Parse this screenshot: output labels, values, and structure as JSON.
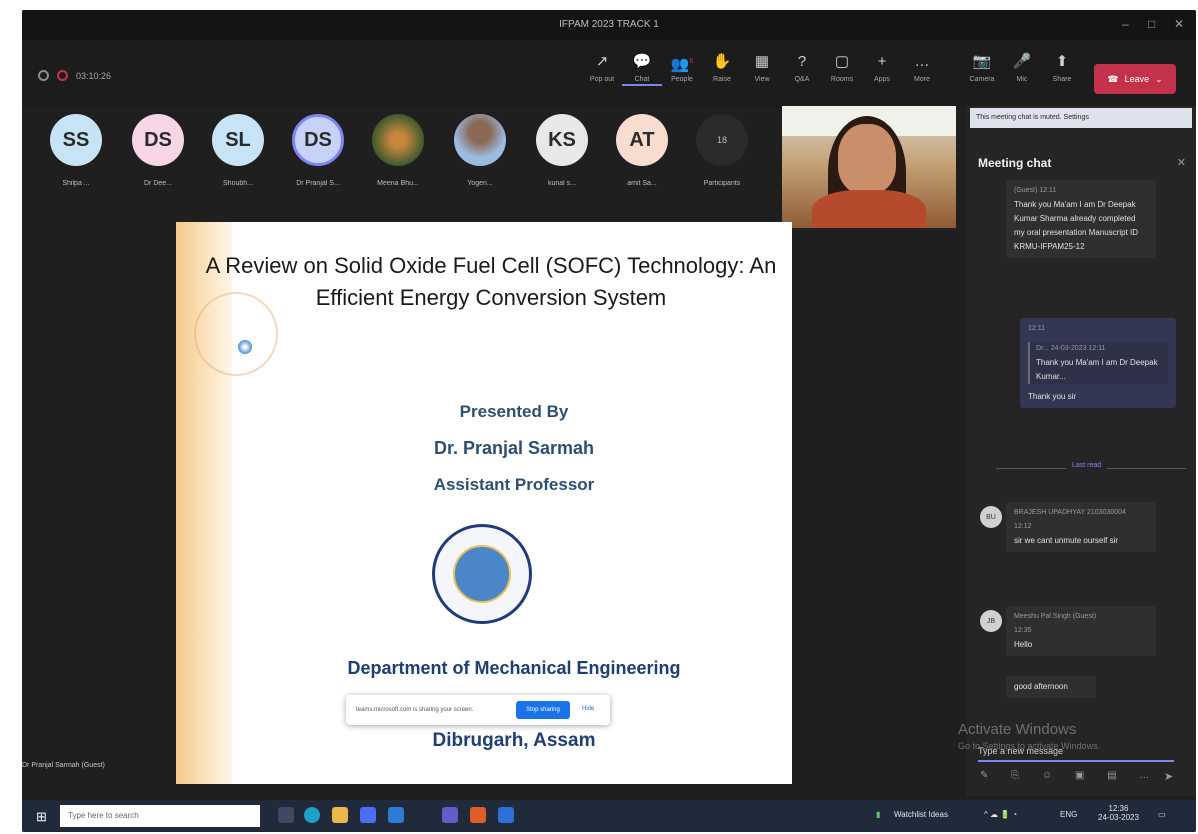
{
  "window": {
    "title": "IFPAM 2023 TRACK 1",
    "controls": [
      "–",
      "□",
      "✕"
    ]
  },
  "meeting": {
    "timer": "03:10:26"
  },
  "toolbar": {
    "buttons": [
      {
        "label": "Pop out",
        "icon": "↗"
      },
      {
        "label": "Chat",
        "icon": "💬"
      },
      {
        "label": "People",
        "icon": "👥"
      },
      {
        "label": "Raise",
        "icon": "✋"
      },
      {
        "label": "View",
        "icon": "▦"
      },
      {
        "label": "Q&A",
        "icon": "?"
      },
      {
        "label": "Rooms",
        "icon": "▢"
      },
      {
        "label": "Apps",
        "icon": "+"
      },
      {
        "label": "More",
        "icon": "…"
      },
      {
        "label": "Camera",
        "icon": "📷"
      },
      {
        "label": "Mic",
        "icon": "🎤"
      },
      {
        "label": "Share",
        "icon": "⬆"
      }
    ],
    "leave_label": "Leave",
    "people_badge": "6"
  },
  "participants": [
    {
      "initials": "SS",
      "name": "Shilpa ...",
      "color": "#c7e3f6"
    },
    {
      "initials": "DS",
      "name": "Dr Dee...",
      "color": "#f6d6e4"
    },
    {
      "initials": "SL",
      "name": "Shoubh...",
      "color": "#c7e3f6"
    },
    {
      "initials": "DS",
      "name": "Dr Pranjal S...",
      "color": "#c7d3f6"
    },
    {
      "initials": "",
      "name": "Meena Bhu...",
      "color": "#3e5a2e"
    },
    {
      "initials": "",
      "name": "Yogen...",
      "color": "#9bbbe0"
    },
    {
      "initials": "KS",
      "name": "kunal s...",
      "color": "#e8e8e8"
    },
    {
      "initials": "AT",
      "name": "amit Sa...",
      "color": "#f8dccf"
    },
    {
      "initials": "18",
      "name": "Participants",
      "color": "#2a2a2a"
    }
  ],
  "slide": {
    "title_line1": "A Review on Solid Oxide Fuel Cell (SOFC) Technology: An",
    "title_line2": "Efficient Energy Conversion System",
    "presented_by": "Presented By",
    "presenter_name": "Dr. Pranjal Sarmah",
    "designation": "Assistant Professor",
    "department": "Department of Mechanical Engineering",
    "location": "Dibrugarh, Assam"
  },
  "share_bar": {
    "text": "teams.microsoft.com is sharing your screen.",
    "stop_label": "Stop sharing",
    "hide_label": "Hide"
  },
  "presenter_label": "Dr Pranjal Sarmah (Guest)",
  "chat": {
    "muted_notice": "This meeting chat is muted. Settings",
    "title": "Meeting chat",
    "msg1": {
      "meta": "(Guest)  12:11",
      "text": "Thank you Ma'am I am Dr Deepak Kumar Sharma already completed my oral presentation Manuscript ID KRMU-IFPAM25-12"
    },
    "msg2": {
      "time": "12:11",
      "quote_meta": "Dr...        24-03-2023 12:11",
      "quote_text": "Thank you Ma'am I am Dr Deepak Kumar...",
      "text": "Thank you sir"
    },
    "last_read": "Last read",
    "msg3": {
      "author": "BRAJESH UPADHYAY 2103030004",
      "time": "12:12",
      "text": "sir we cant unmute ourself sir"
    },
    "msg4": {
      "author": "Meeshu Pal Singh (Guest)",
      "time": "12:35",
      "avatar": "JB",
      "text1": "Hello",
      "text2": "good afternoon"
    },
    "compose_placeholder": "Type a new message"
  },
  "watermark": {
    "line1": "Activate Windows",
    "line2": "Go to Settings to activate Windows."
  },
  "taskbar": {
    "search_placeholder": "Type here to search",
    "watchlist": "Watchlist Ideas",
    "lang": "ENG",
    "time": "12:36",
    "date": "24-03-2023"
  }
}
